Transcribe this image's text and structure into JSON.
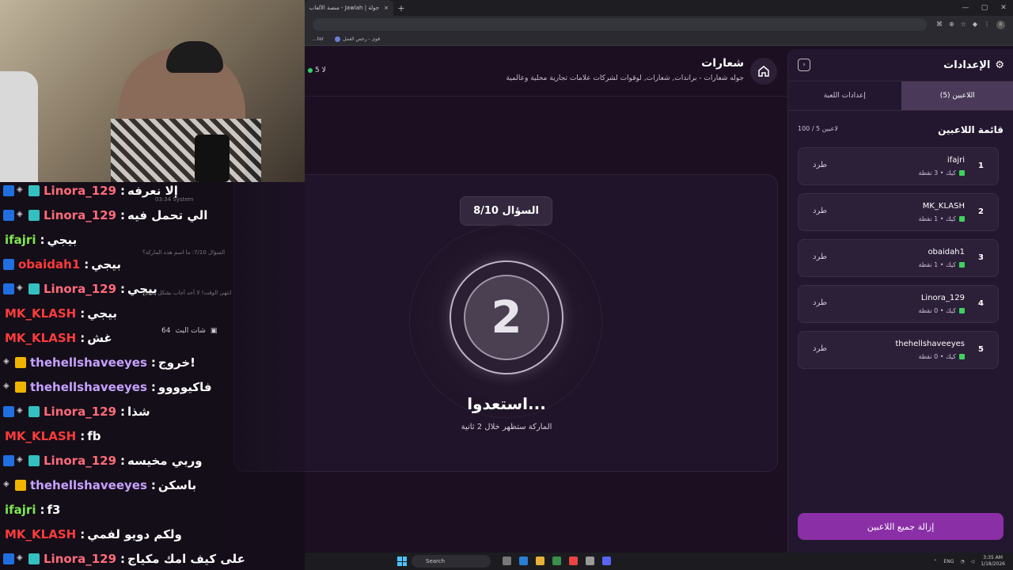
{
  "browser": {
    "tab_title": "جولة | Jawlah - منصة الألعاب الت",
    "tab_close": "×",
    "new_tab": "+",
    "bookmark_1": "...ter",
    "bookmark_2": "قوى - رخص العمل",
    "profile_initial": "R"
  },
  "header": {
    "title": "شعارات",
    "subtitle": "جوله شعارات - براندات, شعارات, لوقوات لشركات علامات تجارية محلية وعالمية",
    "online_count": "5 لا"
  },
  "game": {
    "question_badge": "السؤال 8/10",
    "countdown": "2",
    "ready_text": "استعدوا...",
    "ready_sub": "الماركة ستظهر خلال 2 ثانية"
  },
  "panel": {
    "title": "الإعدادات",
    "tabs": [
      {
        "label": "اللاعبين (5)",
        "active": true
      },
      {
        "label": "إعدادات اللعبة",
        "active": false
      }
    ],
    "list_title": "قائمة اللاعبين",
    "list_count": "100 / 5 لاعبين",
    "players": [
      {
        "rank": "1",
        "name": "ifajri",
        "meta": "كيك • 3 نقطة",
        "kick": "طرد"
      },
      {
        "rank": "2",
        "name": "MK_KLASH",
        "meta": "كيك • 1 نقطة",
        "kick": "طرد"
      },
      {
        "rank": "3",
        "name": "obaidah1",
        "meta": "كيك • 1 نقطة",
        "kick": "طرد"
      },
      {
        "rank": "4",
        "name": "Linora_129",
        "meta": "كيك • 0 نقطة",
        "kick": "طرد"
      },
      {
        "rank": "5",
        "name": "thehellshaveeyes",
        "meta": "كيك • 0 نقطة",
        "kick": "طرد"
      }
    ],
    "remove_all": "إزالة جميع اللاعبين"
  },
  "chat": {
    "title": "شات البث",
    "count": "64",
    "lines": [
      {
        "badges": [
          "blue",
          "shield",
          "mod"
        ],
        "name": "Linora_129",
        "name_color": "#ff6b7a",
        "msg": "إلا نعرفه"
      },
      {
        "badges": [
          "blue",
          "shield",
          "mod"
        ],
        "name": "Linora_129",
        "name_color": "#ff6b7a",
        "msg": "الي تحمل فيه"
      },
      {
        "badges": [],
        "name": "ifajri",
        "name_color": "#7ee84f",
        "msg": "بيجي"
      },
      {
        "badges": [
          "blue"
        ],
        "name": "obaidah1",
        "name_color": "#ff3b3b",
        "msg": "بيجي"
      },
      {
        "badges": [
          "blue",
          "shield",
          "mod"
        ],
        "name": "Linora_129",
        "name_color": "#ff6b7a",
        "msg": "بيجي"
      },
      {
        "badges": [],
        "name": "MK_KLASH",
        "name_color": "#ff3b3b",
        "msg": "بيجي"
      },
      {
        "badges": [],
        "name": "MK_KLASH",
        "name_color": "#ff3b3b",
        "msg": "غش"
      },
      {
        "badges": [
          "shield",
          "gold"
        ],
        "name": "thehellshaveeyes",
        "name_color": "#c6a2ff",
        "msg": "خروج!"
      },
      {
        "badges": [
          "shield",
          "gold"
        ],
        "name": "thehellshaveeyes",
        "name_color": "#c6a2ff",
        "msg": "فاكيوووو"
      },
      {
        "badges": [
          "blue",
          "shield",
          "mod"
        ],
        "name": "Linora_129",
        "name_color": "#ff6b7a",
        "msg": "شذا"
      },
      {
        "badges": [],
        "name": "MK_KLASH",
        "name_color": "#ff3b3b",
        "msg": "fb"
      },
      {
        "badges": [
          "blue",
          "shield",
          "mod"
        ],
        "name": "Linora_129",
        "name_color": "#ff6b7a",
        "msg": "وربي مخيسه"
      },
      {
        "badges": [
          "shield",
          "gold"
        ],
        "name": "thehellshaveeyes",
        "name_color": "#c6a2ff",
        "msg": "باسكن"
      },
      {
        "badges": [],
        "name": "ifajri",
        "name_color": "#7ee84f",
        "msg": "f3"
      },
      {
        "badges": [],
        "name": "MK_KLASH",
        "name_color": "#ff3b3b",
        "msg": "ولكم دويو لفمي"
      },
      {
        "badges": [
          "blue",
          "shield",
          "mod"
        ],
        "name": "Linora_129",
        "name_color": "#ff6b7a",
        "msg": "على كيف امك مكياج"
      }
    ],
    "system_1": "03:34 System",
    "system_2": "السؤال 7/10: ما اسم هذه الماركة؟",
    "system_3": "انتهى الوقت! لا أحد أجاب بشكل صحيح"
  },
  "taskbar": {
    "search": "Search",
    "lang": "ENG",
    "time": "3:35 AM",
    "date": "1/18/2026"
  }
}
